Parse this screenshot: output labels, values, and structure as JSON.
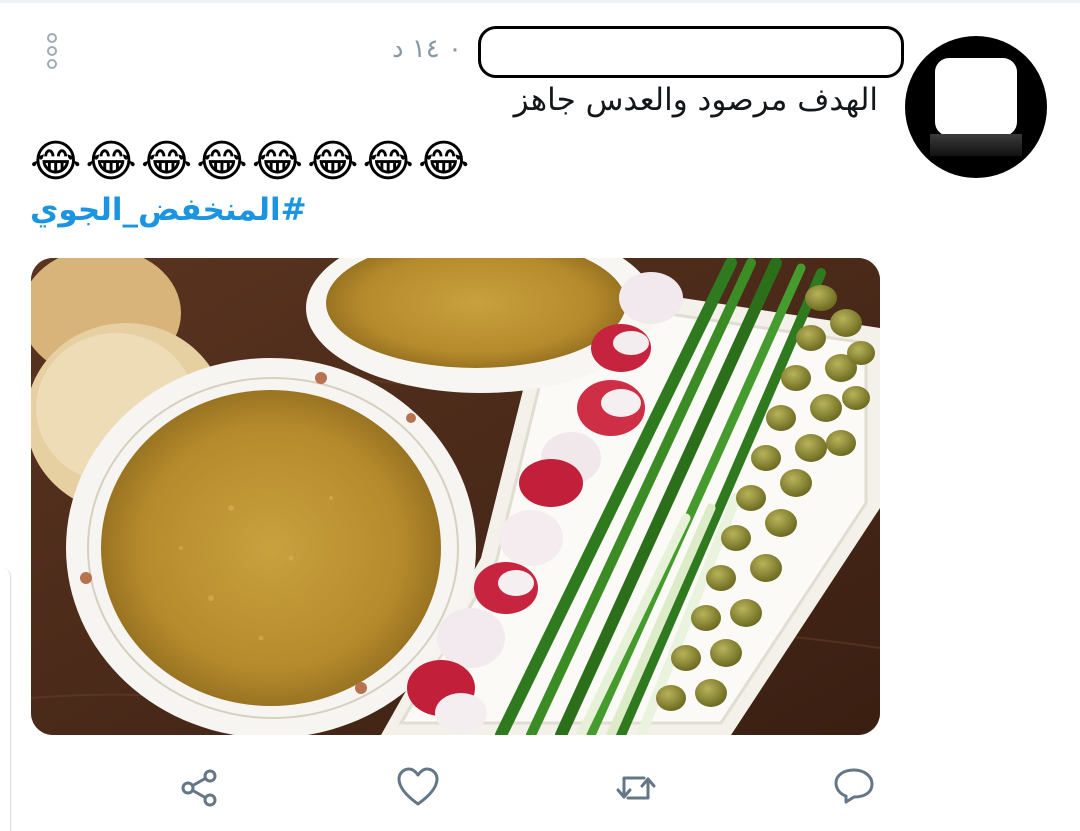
{
  "tweet": {
    "timestamp": "٠ ١٤ د",
    "text": "الهدف مرصود والعدس جاهز",
    "emoji_line": [
      "😂",
      "😂",
      "😂",
      "😂",
      "😂",
      "😂",
      "😂",
      "😂"
    ],
    "hashtag": "#المنخفض_الجوي"
  },
  "icons": {
    "more": "more-vertical-icon",
    "share": "share-icon",
    "like": "heart-icon",
    "retweet": "retweet-icon",
    "reply": "reply-icon"
  },
  "colors": {
    "accent": "#1b95e0",
    "icon_gray": "#657786",
    "text": "#14171a",
    "meta": "#8899a6"
  }
}
